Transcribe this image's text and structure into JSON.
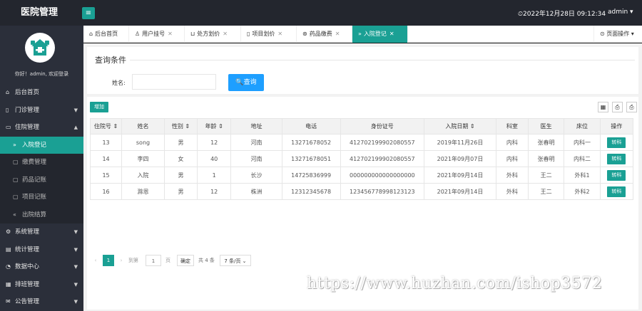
{
  "header": {
    "title": "医院管理",
    "menu_toggle_icon": "hamburger-icon",
    "clock": "⏲2022年12月28日 09:12:34",
    "user": "admin ▾"
  },
  "sidebar": {
    "welcome": "你好！admin, 欢迎登录",
    "items": [
      {
        "label": "后台首页",
        "icon": "⌂"
      },
      {
        "label": "门诊管理",
        "icon": "▯"
      },
      {
        "label": "住院管理",
        "icon": "▭"
      },
      {
        "label": "系统管理",
        "icon": "⚙"
      },
      {
        "label": "统计管理",
        "icon": "▤"
      },
      {
        "label": "数据中心",
        "icon": "◔"
      },
      {
        "label": "排班管理",
        "icon": "▦"
      },
      {
        "label": "公告管理",
        "icon": "✉"
      }
    ],
    "sub_items": [
      {
        "label": "入院登记",
        "icon": "»"
      },
      {
        "label": "缴费管理",
        "icon": "▢"
      },
      {
        "label": "药品记账",
        "icon": "▢"
      },
      {
        "label": "项目记账",
        "icon": "▢"
      },
      {
        "label": "出院结算",
        "icon": "«"
      }
    ]
  },
  "tabs": [
    {
      "label": "后台首页",
      "icon": "⌂",
      "close": ""
    },
    {
      "label": "用户挂号",
      "icon": "♙",
      "close": "✕"
    },
    {
      "label": "处方划价",
      "icon": "⊔",
      "close": "✕"
    },
    {
      "label": "项目划价",
      "icon": "▯",
      "close": "✕"
    },
    {
      "label": "药品缴费",
      "icon": "⊛",
      "close": "✕"
    },
    {
      "label": "入院登记",
      "icon": "»",
      "close": "✕"
    }
  ],
  "page_ops": "⊙ 页面操作 ▾",
  "query": {
    "title": "查询条件",
    "name_label": "姓名:",
    "name_value": "",
    "search_label": "🔍查询"
  },
  "table": {
    "add_label": "增加",
    "tool_icons": [
      "▦",
      "⎙",
      "⎙"
    ],
    "headers": [
      "住院号 ⇕",
      "姓名",
      "性别 ⇕",
      "年龄 ⇕",
      "地址",
      "电话",
      "身份证号",
      "入院日期 ⇕",
      "科室",
      "医生",
      "床位",
      "操作"
    ],
    "rows": [
      [
        "13",
        "song",
        "男",
        "12",
        "河南",
        "13271678052",
        "412702199902080557",
        "2019年11月26日",
        "内科",
        "张春明",
        "内科一",
        "转科"
      ],
      [
        "14",
        "李四",
        "女",
        "40",
        "河南",
        "13271678051",
        "412702199902080557",
        "2021年09月07日",
        "内科",
        "张春明",
        "内科二",
        "转科"
      ],
      [
        "15",
        "入院",
        "男",
        "1",
        "长沙",
        "14725836999",
        "000000000000000000",
        "2021年09月14日",
        "外科",
        "王二",
        "外科1",
        "转科"
      ],
      [
        "16",
        "滁恩",
        "男",
        "12",
        "株洲",
        "12312345678",
        "123456778998123123",
        "2021年09月14日",
        "外科",
        "王二",
        "外科2",
        "转科"
      ]
    ]
  },
  "pager": {
    "prev": "‹",
    "current": "1",
    "next": "›",
    "goto": "到第",
    "page_input": "1",
    "page_unit": "页",
    "confirm": "确定",
    "total": "共 4 条",
    "per_page": "7 条/页 ⌄"
  },
  "watermark": "https://www.huzhan.com/ishop3572",
  "colors": {
    "accent": "#1aa094",
    "search": "#1e9fff",
    "sidebar": "#2b2f3a"
  }
}
